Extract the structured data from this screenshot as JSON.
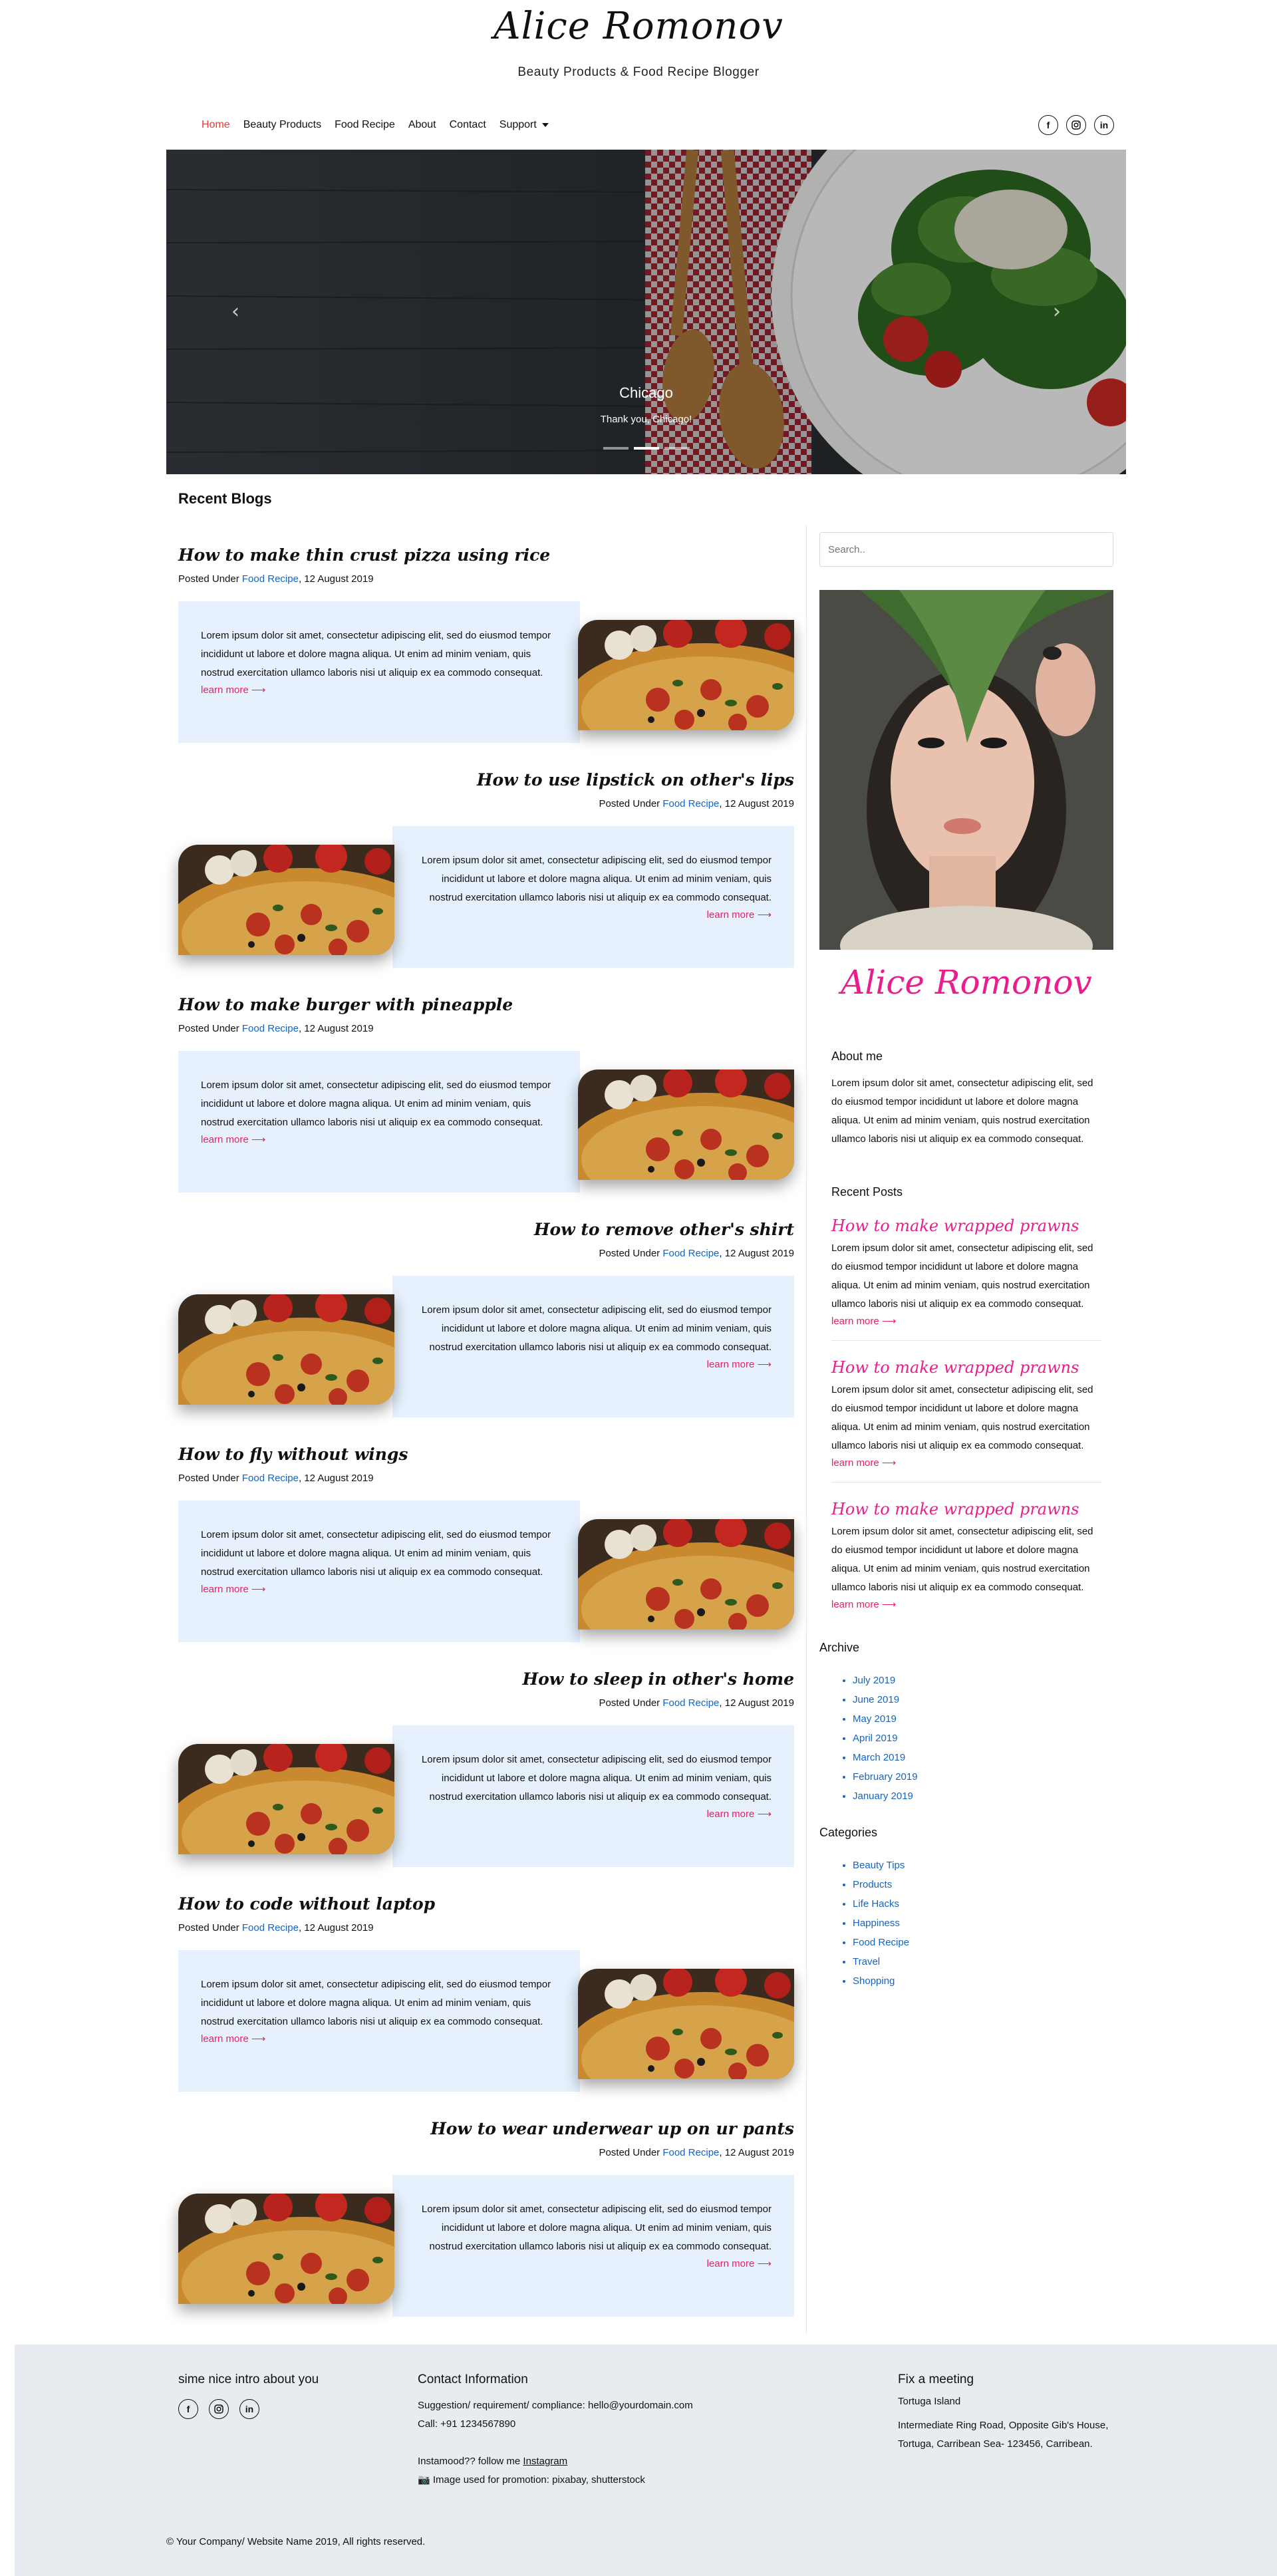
{
  "header": {
    "title": "Alice Romonov",
    "tagline": "Beauty Products & Food Recipe Blogger"
  },
  "nav": {
    "items": [
      {
        "label": "Home",
        "active": true
      },
      {
        "label": "Beauty Products"
      },
      {
        "label": "Food Recipe"
      },
      {
        "label": "About"
      },
      {
        "label": "Contact"
      },
      {
        "label": "Support"
      }
    ],
    "social_icons": [
      "facebook-icon",
      "instagram-icon",
      "linkedin-icon"
    ]
  },
  "hero": {
    "caption_title": "Chicago",
    "caption_text": "Thank you, Chicago!",
    "slides": 3,
    "active_slide": 2
  },
  "main": {
    "section_title": "Recent Blogs",
    "posts": [
      {
        "title": "How to make thin crust pizza using rice",
        "posted_under": "Posted Under ",
        "category": "Food Recipe",
        "date": ", 12 August 2019",
        "body": "Lorem ipsum dolor sit amet, consectetur adipiscing elit, sed do eiusmod tempor incididunt ut labore et dolore magna aliqua. Ut enim ad minim veniam, quis nostrud exercitation ullamco laboris nisi ut aliquip ex ea commodo consequat.",
        "link": "learn more ⟶"
      },
      {
        "title": "How to use lipstick on other's lips",
        "posted_under": "Posted Under ",
        "category": "Food Recipe",
        "date": ", 12 August 2019",
        "body": "Lorem ipsum dolor sit amet, consectetur adipiscing elit, sed do eiusmod tempor incididunt ut labore et dolore magna aliqua. Ut enim ad minim veniam, quis nostrud exercitation ullamco laboris nisi ut aliquip ex ea commodo consequat.",
        "link": "learn more ⟶"
      },
      {
        "title": "How to make burger with pineapple",
        "posted_under": "Posted Under ",
        "category": "Food Recipe",
        "date": ", 12 August 2019",
        "body": "Lorem ipsum dolor sit amet, consectetur adipiscing elit, sed do eiusmod tempor incididunt ut labore et dolore magna aliqua. Ut enim ad minim veniam, quis nostrud exercitation ullamco laboris nisi ut aliquip ex ea commodo consequat.",
        "link": "learn more ⟶"
      },
      {
        "title": "How to remove other's shirt",
        "posted_under": "Posted Under ",
        "category": "Food Recipe",
        "date": ", 12 August 2019",
        "body": "Lorem ipsum dolor sit amet, consectetur adipiscing elit, sed do eiusmod tempor incididunt ut labore et dolore magna aliqua. Ut enim ad minim veniam, quis nostrud exercitation ullamco laboris nisi ut aliquip ex ea commodo consequat.",
        "link": "learn more ⟶"
      },
      {
        "title": "How to fly without wings",
        "posted_under": "Posted Under ",
        "category": "Food Recipe",
        "date": ", 12 August 2019",
        "body": "Lorem ipsum dolor sit amet, consectetur adipiscing elit, sed do eiusmod tempor incididunt ut labore et dolore magna aliqua. Ut enim ad minim veniam, quis nostrud exercitation ullamco laboris nisi ut aliquip ex ea commodo consequat.",
        "link": "learn more ⟶"
      },
      {
        "title": "How to sleep in other's home",
        "posted_under": "Posted Under ",
        "category": "Food Recipe",
        "date": ", 12 August 2019",
        "body": "Lorem ipsum dolor sit amet, consectetur adipiscing elit, sed do eiusmod tempor incididunt ut labore et dolore magna aliqua. Ut enim ad minim veniam, quis nostrud exercitation ullamco laboris nisi ut aliquip ex ea commodo consequat.",
        "link": "learn more ⟶"
      },
      {
        "title": "How to code without laptop",
        "posted_under": "Posted Under ",
        "category": "Food Recipe",
        "date": ", 12 August 2019",
        "body": "Lorem ipsum dolor sit amet, consectetur adipiscing elit, sed do eiusmod tempor incididunt ut labore et dolore magna aliqua. Ut enim ad minim veniam, quis nostrud exercitation ullamco laboris nisi ut aliquip ex ea commodo consequat.",
        "link": "learn more ⟶"
      },
      {
        "title": "How to wear underwear up on ur pants",
        "posted_under": "Posted Under ",
        "category": "Food Recipe",
        "date": ", 12 August 2019",
        "body": "Lorem ipsum dolor sit amet, consectetur adipiscing elit, sed do eiusmod tempor incididunt ut labore et dolore magna aliqua. Ut enim ad minim veniam, quis nostrud exercitation ullamco laboris nisi ut aliquip ex ea commodo consequat.",
        "link": "learn more ⟶"
      }
    ]
  },
  "sidebar": {
    "search_placeholder": "Search..",
    "profile_name": "Alice Romonov",
    "about_title": "About me",
    "about_text": "Lorem ipsum dolor sit amet, consectetur adipiscing elit, sed do eiusmod tempor incididunt ut labore et dolore magna aliqua. Ut enim ad minim veniam, quis nostrud exercitation ullamco laboris nisi ut aliquip ex ea commodo consequat.",
    "recent_title": "Recent Posts",
    "recent_posts": [
      {
        "title": "How to make wrapped prawns",
        "body": "Lorem ipsum dolor sit amet, consectetur adipiscing elit, sed do eiusmod tempor incididunt ut labore et dolore magna aliqua. Ut enim ad minim veniam, quis nostrud exercitation ullamco laboris nisi ut aliquip ex ea commodo consequat.",
        "link": "learn more ⟶"
      },
      {
        "title": "How to make wrapped prawns",
        "body": "Lorem ipsum dolor sit amet, consectetur adipiscing elit, sed do eiusmod tempor incididunt ut labore et dolore magna aliqua. Ut enim ad minim veniam, quis nostrud exercitation ullamco laboris nisi ut aliquip ex ea commodo consequat.",
        "link": "learn more ⟶"
      },
      {
        "title": "How to make wrapped prawns",
        "body": "Lorem ipsum dolor sit amet, consectetur adipiscing elit, sed do eiusmod tempor incididunt ut labore et dolore magna aliqua. Ut enim ad minim veniam, quis nostrud exercitation ullamco laboris nisi ut aliquip ex ea commodo consequat.",
        "link": "learn more ⟶"
      }
    ],
    "archive_title": "Archive",
    "archive": [
      "July 2019",
      "June 2019",
      "May 2019",
      "April 2019",
      "March 2019",
      "February 2019",
      "January 2019"
    ],
    "categories_title": "Categories",
    "categories": [
      "Beauty Tips",
      "Products",
      "Life Hacks",
      "Happiness",
      "Food Recipe",
      "Travel",
      "Shopping"
    ]
  },
  "footer": {
    "intro_title": "sime nice intro about you",
    "contact_title": "Contact Information",
    "contact_line1": "Suggestion/ requirement/ compliance: hello@yourdomain.com",
    "contact_line2": "Call: +91 1234567890",
    "insta_prefix": "Instamood?? follow me ",
    "insta_link": "Instagram",
    "image_credit": "📷 Image used for promotion: pixabay, shutterstock",
    "meet_title": "Fix a meeting",
    "meet_place": "Tortuga Island",
    "meet_address": "Intermediate Ring Road, Opposite Gib's House, Tortuga, Carribean Sea- 123456, Carribean.",
    "copyright": "© Your Company/ Website Name 2019, All rights reserved."
  },
  "colors": {
    "accent_pink": "#e91e8c",
    "link_blue": "#1565c0",
    "nav_active": "#e53935",
    "post_bg": "#e6f1fd",
    "footer_bg": "#e8ebef"
  }
}
